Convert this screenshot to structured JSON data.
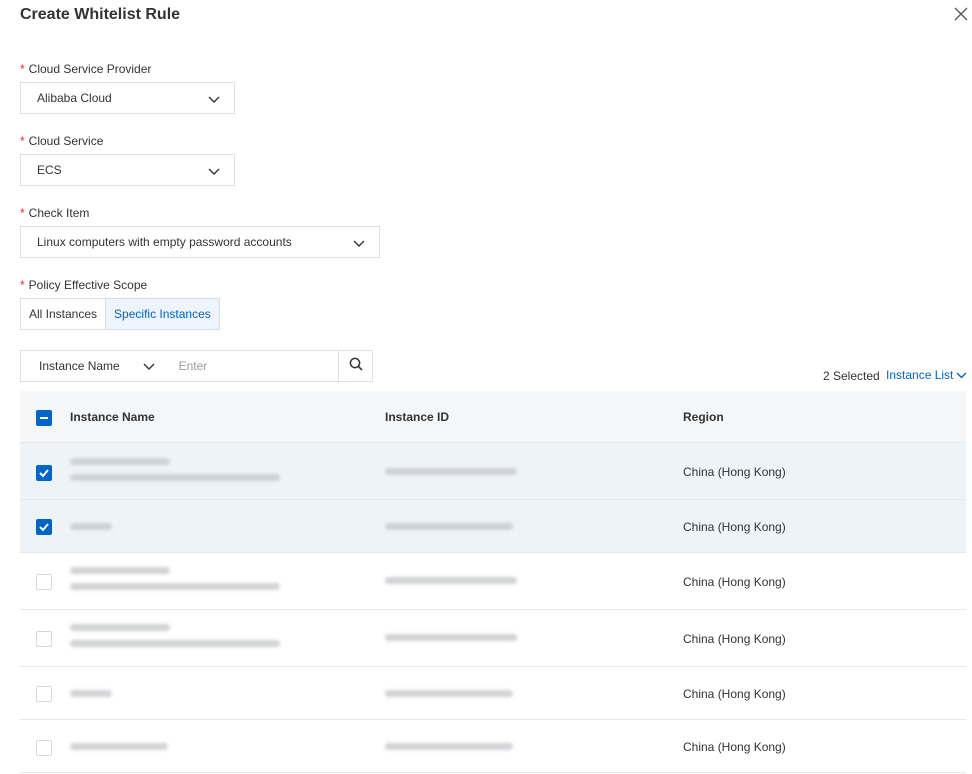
{
  "dialog": {
    "title": "Create Whitelist Rule"
  },
  "form": {
    "provider": {
      "label": "Cloud Service Provider",
      "value": "Alibaba Cloud"
    },
    "service": {
      "label": "Cloud Service",
      "value": "ECS"
    },
    "check_item": {
      "label": "Check Item",
      "value": "Linux computers with empty password accounts"
    },
    "scope": {
      "label": "Policy Effective Scope",
      "options": [
        "All Instances",
        "Specific Instances"
      ],
      "active": "Specific Instances"
    }
  },
  "search": {
    "type": "Instance Name",
    "placeholder": "Enter"
  },
  "selection": {
    "count_text": "2 Selected",
    "list_link": "Instance List"
  },
  "table": {
    "columns": [
      "Instance Name",
      "Instance ID",
      "Region"
    ],
    "rows": [
      {
        "checked": true,
        "region": "China (Hong Kong)"
      },
      {
        "checked": true,
        "region": "China (Hong Kong)"
      },
      {
        "checked": false,
        "region": "China (Hong Kong)"
      },
      {
        "checked": false,
        "region": "China (Hong Kong)"
      },
      {
        "checked": false,
        "region": "China (Hong Kong)"
      },
      {
        "checked": false,
        "region": "China (Hong Kong)"
      }
    ]
  },
  "colors": {
    "accent": "#0064c8",
    "required": "#e5311b",
    "selected_row": "#eef3f8",
    "header_bg": "#f4f6f8"
  }
}
